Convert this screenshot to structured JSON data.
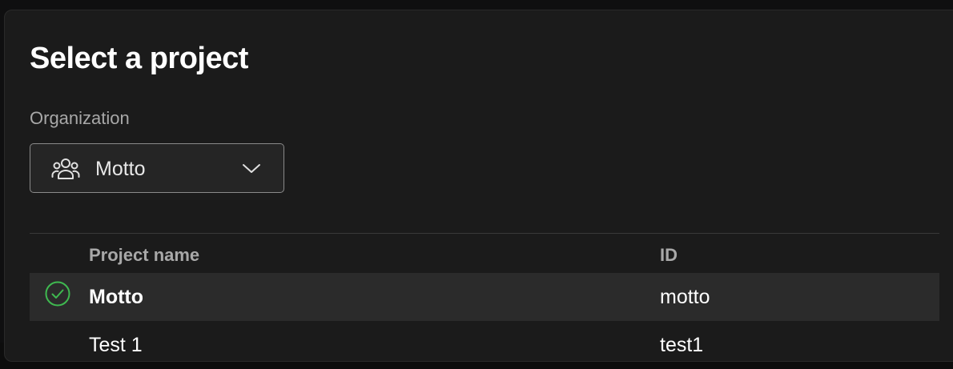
{
  "dialog": {
    "title": "Select a project"
  },
  "organization": {
    "label": "Organization",
    "selected": "Motto",
    "icon": "people-group-icon"
  },
  "table": {
    "columns": [
      "Project name",
      "ID"
    ],
    "rows": [
      {
        "name": "Motto",
        "id": "motto",
        "selected": true
      },
      {
        "name": "Test 1",
        "id": "test1",
        "selected": false
      }
    ]
  },
  "colors": {
    "background": "#1b1b1b",
    "selected_row": "#2b2b2b",
    "check_green": "#3fb950",
    "muted_text": "#a8a8a8"
  }
}
